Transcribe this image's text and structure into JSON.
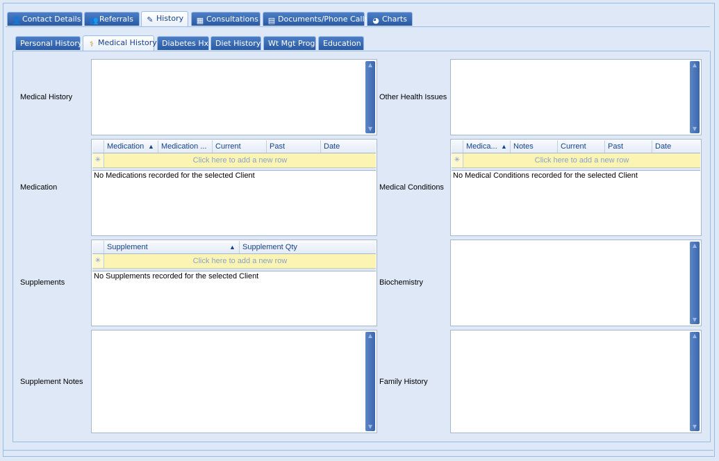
{
  "main_tabs": [
    {
      "label": "Contact Details",
      "icon": "person-icon"
    },
    {
      "label": "Referrals",
      "icon": "people-icon"
    },
    {
      "label": "History",
      "icon": "pencil-icon"
    },
    {
      "label": "Consultations",
      "icon": "calendar-icon"
    },
    {
      "label": "Documents/Phone Calls",
      "icon": "document-icon"
    },
    {
      "label": "Charts",
      "icon": "pie-chart-icon"
    }
  ],
  "sub_tabs": [
    {
      "label": "Personal History"
    },
    {
      "label": "Medical History",
      "icon": "caduceus-icon"
    },
    {
      "label": "Diabetes Hx"
    },
    {
      "label": "Diet History"
    },
    {
      "label": "Wt Mgt Prog"
    },
    {
      "label": "Education"
    }
  ],
  "fields": {
    "medical_history": "Medical History",
    "medication": "Medication",
    "supplements": "Supplements",
    "supplement_notes": "Supplement Notes",
    "other_health_issues": "Other Health Issues",
    "medical_conditions": "Medical Conditions",
    "biochemistry": "Biochemistry",
    "family_history": "Family History"
  },
  "medication_grid": {
    "columns": [
      "Medication",
      "Medication ...",
      "Current",
      "Past",
      "Date"
    ],
    "new_row": "Click here to add a new row",
    "empty": "No Medications recorded for the selected Client"
  },
  "conditions_grid": {
    "columns": [
      "Medica...",
      "Notes",
      "Current",
      "Past",
      "Date"
    ],
    "new_row": "Click here to add a new row",
    "empty": "No Medical Conditions recorded for the selected Client"
  },
  "supplements_grid": {
    "columns": [
      "Supplement",
      "Supplement Qty"
    ],
    "new_row": "Click here to add a new row",
    "empty": "No Supplements recorded for the selected Client"
  },
  "glyphs": {
    "sort_asc": "▲",
    "new_row_marker": "✳",
    "scroll_up": "▲",
    "scroll_down": "▼"
  }
}
